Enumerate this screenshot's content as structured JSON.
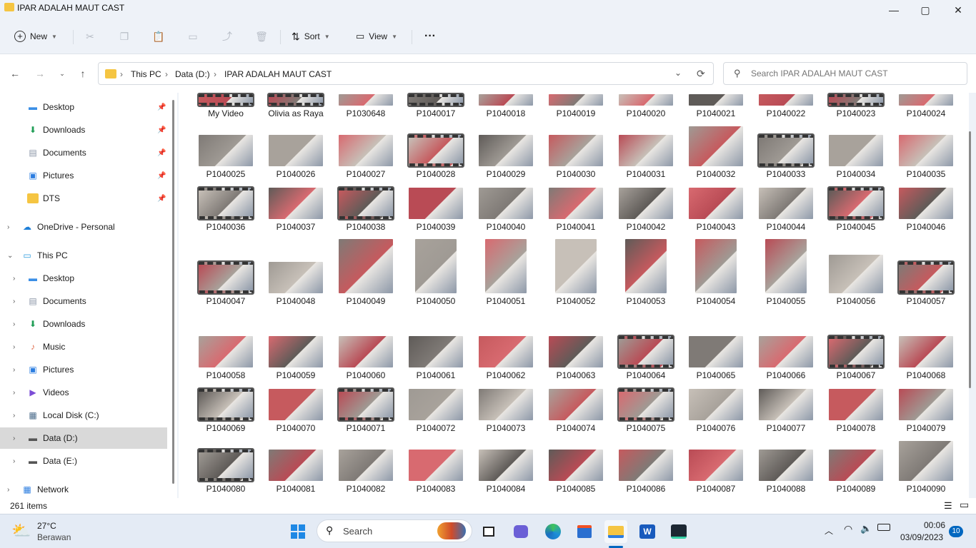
{
  "window": {
    "title": "IPAR ADALAH MAUT CAST",
    "controls": {
      "minimize": "—",
      "maximize": "▢",
      "close": "✕"
    }
  },
  "toolbar": {
    "new_label": "New",
    "sort_label": "Sort",
    "view_label": "View",
    "more_label": "···"
  },
  "address": {
    "crumbs": [
      "This PC",
      "Data (D:)",
      "IPAR ADALAH MAUT CAST"
    ],
    "separator": "›"
  },
  "search": {
    "placeholder": "Search IPAR ADALAH MAUT CAST"
  },
  "sidebar": {
    "items": [
      {
        "label": "Desktop",
        "icon": "desktop-icon",
        "color": "#3a8ee6",
        "pinned": true
      },
      {
        "label": "Downloads",
        "icon": "downloads-icon",
        "color": "#1f9d55",
        "pinned": true
      },
      {
        "label": "Documents",
        "icon": "documents-icon",
        "color": "#8a94a6",
        "pinned": true
      },
      {
        "label": "Pictures",
        "icon": "pictures-icon",
        "color": "#2b7de0",
        "pinned": true
      },
      {
        "label": "DTS",
        "icon": "folder-icon",
        "color": "#f5c542",
        "pinned": true
      },
      {
        "label": "OneDrive - Personal",
        "icon": "onedrive-icon",
        "color": "#1e7fd8"
      },
      {
        "label": "This PC",
        "icon": "this-pc-icon",
        "color": "#2b9bdd"
      },
      {
        "label": "Desktop",
        "icon": "desktop-icon",
        "color": "#3a8ee6"
      },
      {
        "label": "Documents",
        "icon": "documents-icon",
        "color": "#8a94a6"
      },
      {
        "label": "Downloads",
        "icon": "downloads-icon",
        "color": "#1f9d55"
      },
      {
        "label": "Music",
        "icon": "music-icon",
        "color": "#e06c4c"
      },
      {
        "label": "Pictures",
        "icon": "pictures-icon",
        "color": "#2b7de0"
      },
      {
        "label": "Videos",
        "icon": "videos-icon",
        "color": "#7c4dd6"
      },
      {
        "label": "Local Disk (C:)",
        "icon": "local-disk-icon",
        "color": "#4a6b8a"
      },
      {
        "label": "Data (D:)",
        "icon": "drive-icon",
        "color": "#555555",
        "selected": true
      },
      {
        "label": "Data (E:)",
        "icon": "drive-icon",
        "color": "#555555"
      },
      {
        "label": "Network",
        "icon": "network-icon",
        "color": "#2b7de0"
      }
    ]
  },
  "files": {
    "row0": [
      "My Video",
      "Olivia as Raya",
      "P1030648",
      "P1040017",
      "P1040018",
      "P1040019",
      "P1040020",
      "P1040021",
      "P1040022",
      "P1040023",
      "P1040024"
    ],
    "row1": [
      "P1040025",
      "P1040026",
      "P1040027",
      "P1040028",
      "P1040029",
      "P1040030",
      "P1040031",
      "P1040032",
      "P1040033",
      "P1040034",
      "P1040035"
    ],
    "row2": [
      "P1040036",
      "P1040037",
      "P1040038",
      "P1040039",
      "P1040040",
      "P1040041",
      "P1040042",
      "P1040043",
      "P1040044",
      "P1040045",
      "P1040046"
    ],
    "row3": [
      "P1040047",
      "P1040048",
      "P1040049",
      "P1040050",
      "P1040051",
      "P1040052",
      "P1040053",
      "P1040054",
      "P1040055",
      "P1040056",
      "P1040057"
    ],
    "row4": [
      "P1040058",
      "P1040059",
      "P1040060",
      "P1040061",
      "P1040062",
      "P1040063",
      "P1040064",
      "P1040065",
      "P1040066",
      "P1040067",
      "P1040068"
    ],
    "row5": [
      "P1040069",
      "P1040070",
      "P1040071",
      "P1040072",
      "P1040073",
      "P1040074",
      "P1040075",
      "P1040076",
      "P1040077",
      "P1040078",
      "P1040079"
    ],
    "row6": [
      "P1040080",
      "P1040081",
      "P1040082",
      "P1040083",
      "P1040084",
      "P1040085",
      "P1040086",
      "P1040087",
      "P1040088",
      "P1040089",
      "P1040090"
    ]
  },
  "status": {
    "item_count": "261 items"
  },
  "taskbar": {
    "weather_temp": "27°C",
    "weather_desc": "Berawan",
    "search_label": "Search",
    "time": "00:06",
    "date": "03/09/2023",
    "notif_count": "10"
  },
  "colors": {
    "accent": "#0067c0",
    "selected_bg": "#d9d9d9"
  }
}
